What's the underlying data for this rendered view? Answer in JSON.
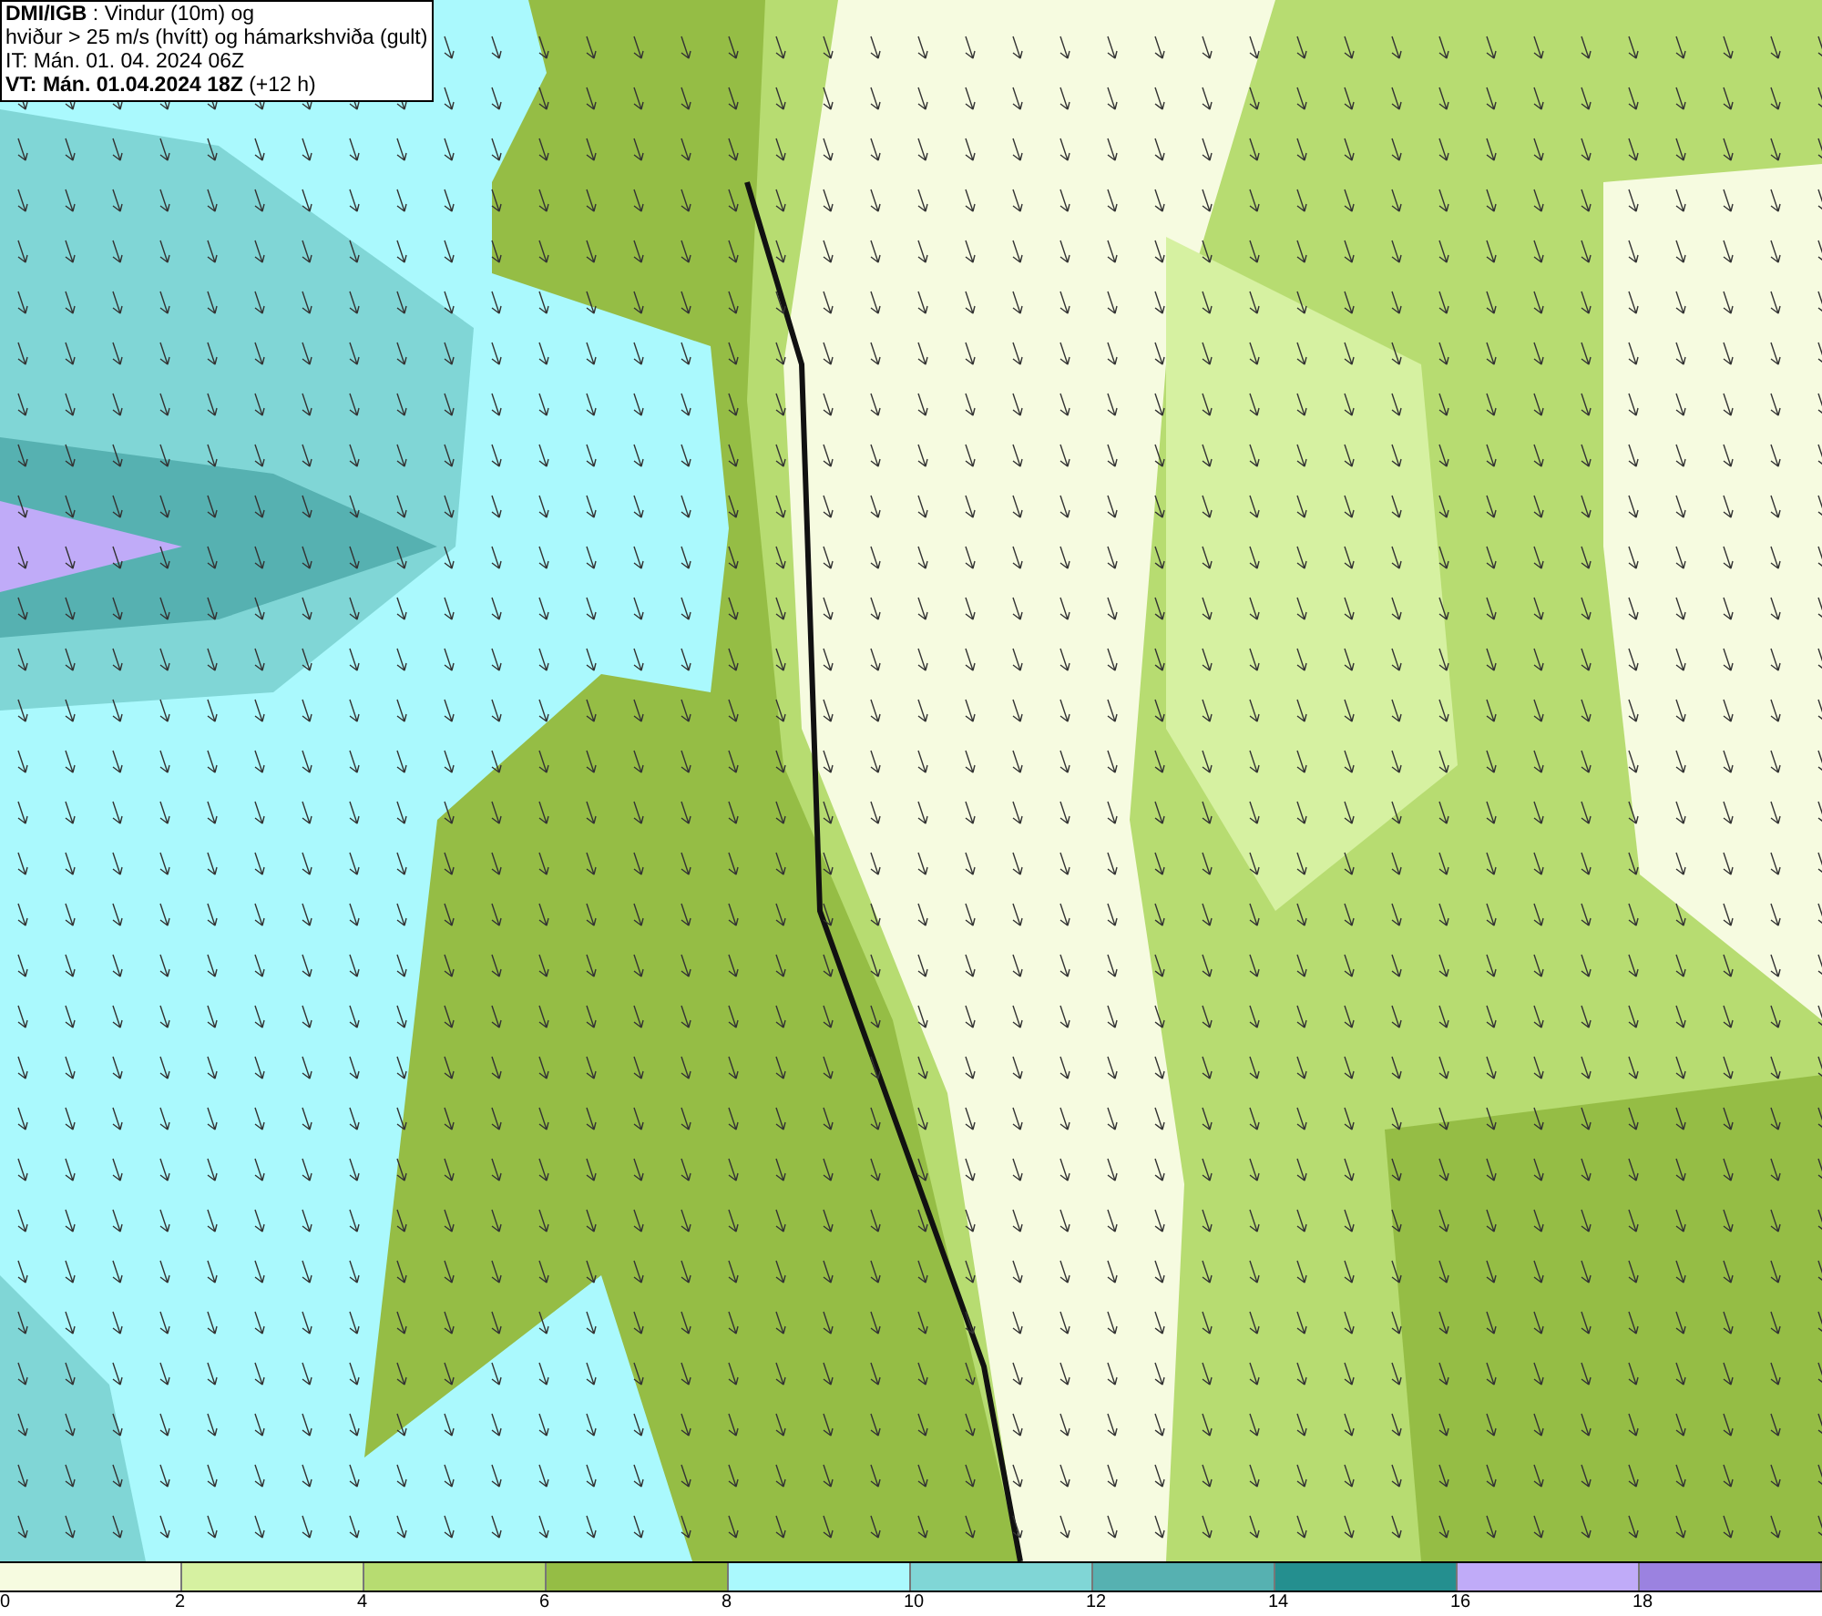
{
  "info_box": {
    "lines": [
      "**DMI/IGB** : Vindur (10m) og",
      "hviður > 25 m/s (hvítt) og hámarkshviða (gult)",
      "IT: Mán. 01. 04. 2024 06Z",
      "**VT: Mán. 01.04.2024 18Z** (+12 h)"
    ]
  },
  "legend": {
    "segments": [
      {
        "color": "#f6fbe0"
      },
      {
        "color": "#d6f1a1"
      },
      {
        "color": "#b7dc71"
      },
      {
        "color": "#95bd45"
      },
      {
        "color": "#aaf9fd"
      },
      {
        "color": "#80d6d6"
      },
      {
        "color": "#56b1b1"
      },
      {
        "color": "#248f8f"
      },
      {
        "color": "#c0abf8"
      },
      {
        "color": "#9b82e0"
      }
    ],
    "ticks": [
      "0",
      "2",
      "4",
      "6",
      "8",
      "10",
      "12",
      "14",
      "16",
      "18"
    ]
  }
}
